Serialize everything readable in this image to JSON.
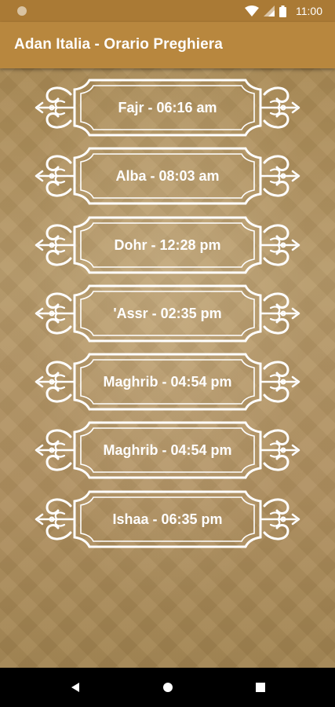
{
  "status_bar": {
    "time": "11:00"
  },
  "app_bar": {
    "title": "Adan Italia - Orario Preghiera"
  },
  "prayers": [
    {
      "label": "Fajr - 06:16 am"
    },
    {
      "label": "Alba - 08:03 am"
    },
    {
      "label": "Dohr - 12:28 pm"
    },
    {
      "label": "'Assr - 02:35 pm"
    },
    {
      "label": "Maghrib - 04:54 pm"
    },
    {
      "label": "Maghrib - 04:54 pm"
    },
    {
      "label": "Ishaa - 06:35 pm"
    }
  ],
  "nav": {
    "back": "back-icon",
    "home": "home-icon",
    "recents": "recents-icon"
  },
  "colors": {
    "app_bar": "#b8873e",
    "status_bar": "#aa7a35",
    "frame": "#ffffff"
  }
}
